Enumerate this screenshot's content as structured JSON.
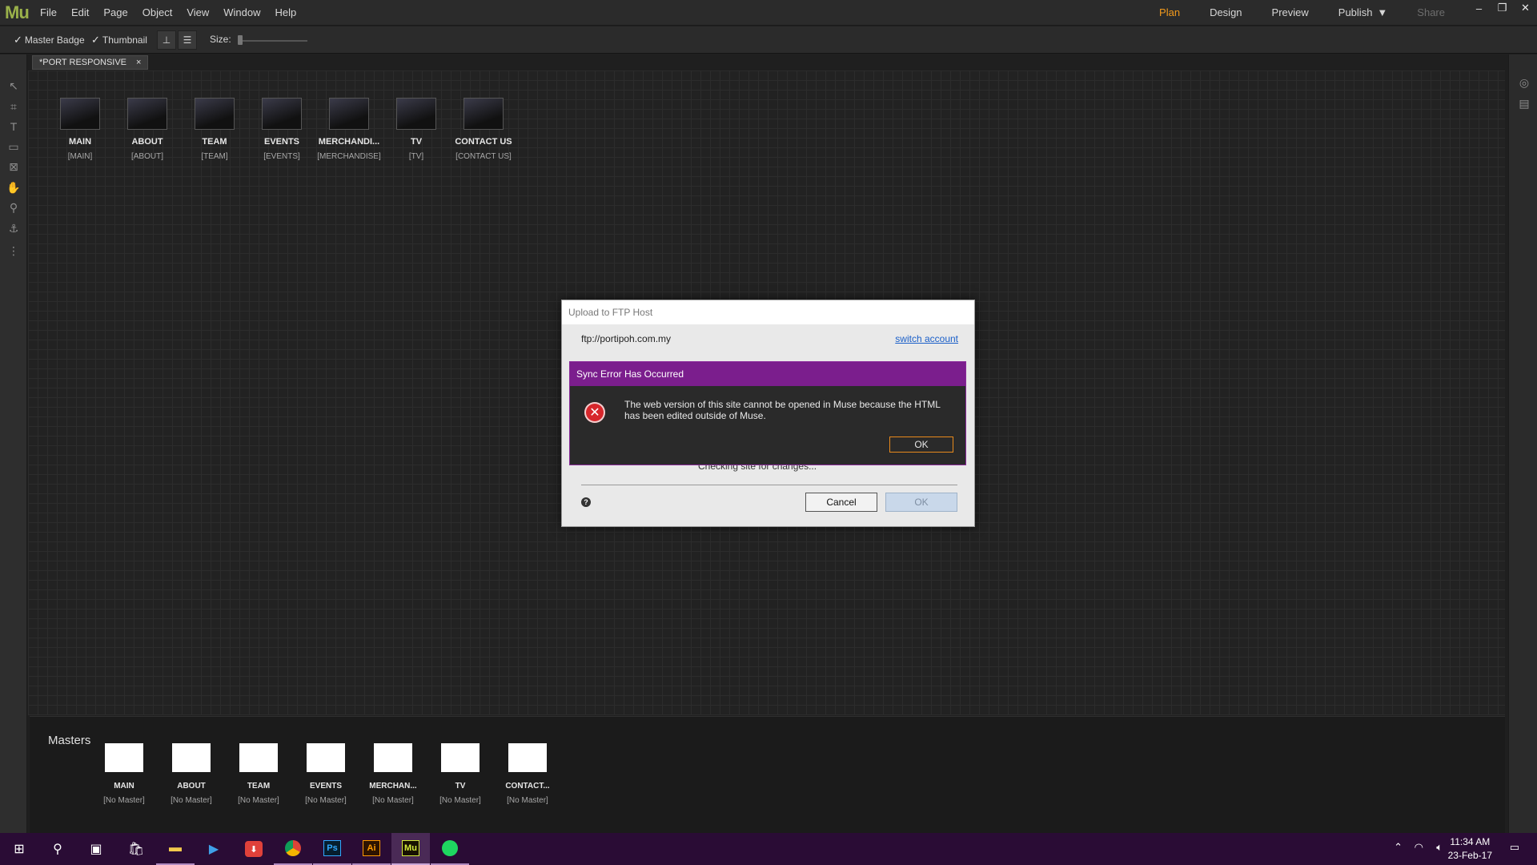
{
  "app": {
    "logo": "Mu",
    "menu": [
      "File",
      "Edit",
      "Page",
      "Object",
      "View",
      "Window",
      "Help"
    ],
    "modes": {
      "plan": "Plan",
      "design": "Design",
      "preview": "Preview",
      "publish": "Publish",
      "share": "Share"
    },
    "accent": "#f29a1c"
  },
  "options": {
    "master_badge": "Master Badge",
    "thumbnail": "Thumbnail",
    "size_label": "Size:",
    "size_value": 0
  },
  "tab": {
    "title": "*PORT RESPONSIVE",
    "close": "×"
  },
  "pages": [
    {
      "name": "MAIN",
      "master": "[MAIN]"
    },
    {
      "name": "ABOUT",
      "master": "[ABOUT]"
    },
    {
      "name": "TEAM",
      "master": "[TEAM]"
    },
    {
      "name": "EVENTS",
      "master": "[EVENTS]"
    },
    {
      "name": "MERCHANDI...",
      "master": "[MERCHANDISE]"
    },
    {
      "name": "TV",
      "master": "[TV]"
    },
    {
      "name": "CONTACT US",
      "master": "[CONTACT US]"
    }
  ],
  "masters": {
    "label": "Masters",
    "items": [
      {
        "name": "MAIN",
        "master": "[No Master]"
      },
      {
        "name": "ABOUT",
        "master": "[No Master]"
      },
      {
        "name": "TEAM",
        "master": "[No Master]"
      },
      {
        "name": "EVENTS",
        "master": "[No Master]"
      },
      {
        "name": "MERCHAN...",
        "master": "[No Master]"
      },
      {
        "name": "TV",
        "master": "[No Master]"
      },
      {
        "name": "CONTACT...",
        "master": "[No Master]"
      }
    ]
  },
  "ftp_dialog": {
    "title": "Upload to FTP Host",
    "host": "ftp://portipoh.com.my",
    "switch_account": "switch account",
    "status": "Checking site for changes...",
    "cancel": "Cancel",
    "ok": "OK"
  },
  "error_dialog": {
    "title": "Sync Error Has Occurred",
    "message": "The web version of this site cannot be opened in Muse because the HTML has been edited outside of Muse.",
    "ok": "OK",
    "title_color": "#7b1e8d"
  },
  "taskbar": {
    "time": "11:34 AM",
    "date": "23-Feb-17",
    "apps": [
      "Ps",
      "Ai",
      "Mu"
    ]
  }
}
